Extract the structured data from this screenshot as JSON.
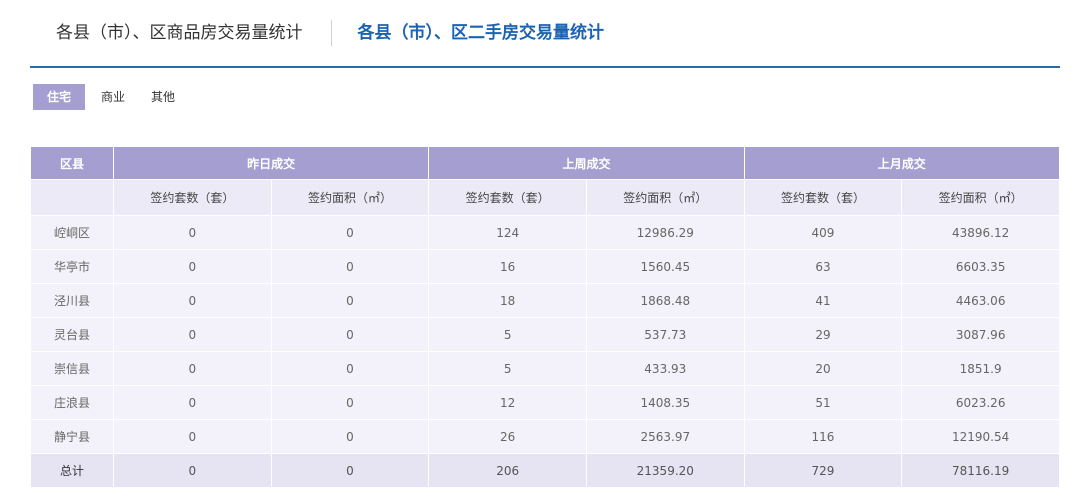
{
  "header": {
    "tab_commercial": "各县（市）、区商品房交易量统计",
    "tab_secondhand": "各县（市）、区二手房交易量统计"
  },
  "subtabs": [
    "住宅",
    "商业",
    "其他"
  ],
  "table": {
    "col_district": "区县",
    "groups": [
      "昨日成交",
      "上周成交",
      "上月成交"
    ],
    "subheaders": [
      "签约套数（套）",
      "签约面积（㎡）",
      "签约套数（套）",
      "签约面积（㎡）",
      "签约套数（套）",
      "签约面积（㎡）"
    ],
    "rows": [
      [
        "崆峒区",
        "0",
        "0",
        "124",
        "12986.29",
        "409",
        "43896.12"
      ],
      [
        "华亭市",
        "0",
        "0",
        "16",
        "1560.45",
        "63",
        "6603.35"
      ],
      [
        "泾川县",
        "0",
        "0",
        "18",
        "1868.48",
        "41",
        "4463.06"
      ],
      [
        "灵台县",
        "0",
        "0",
        "5",
        "537.73",
        "29",
        "3087.96"
      ],
      [
        "崇信县",
        "0",
        "0",
        "5",
        "433.93",
        "20",
        "1851.9"
      ],
      [
        "庄浪县",
        "0",
        "0",
        "12",
        "1408.35",
        "51",
        "6023.26"
      ],
      [
        "静宁县",
        "0",
        "0",
        "26",
        "2563.97",
        "116",
        "12190.54"
      ]
    ],
    "total": [
      "总计",
      "0",
      "0",
      "206",
      "21359.20",
      "729",
      "78116.19"
    ]
  }
}
